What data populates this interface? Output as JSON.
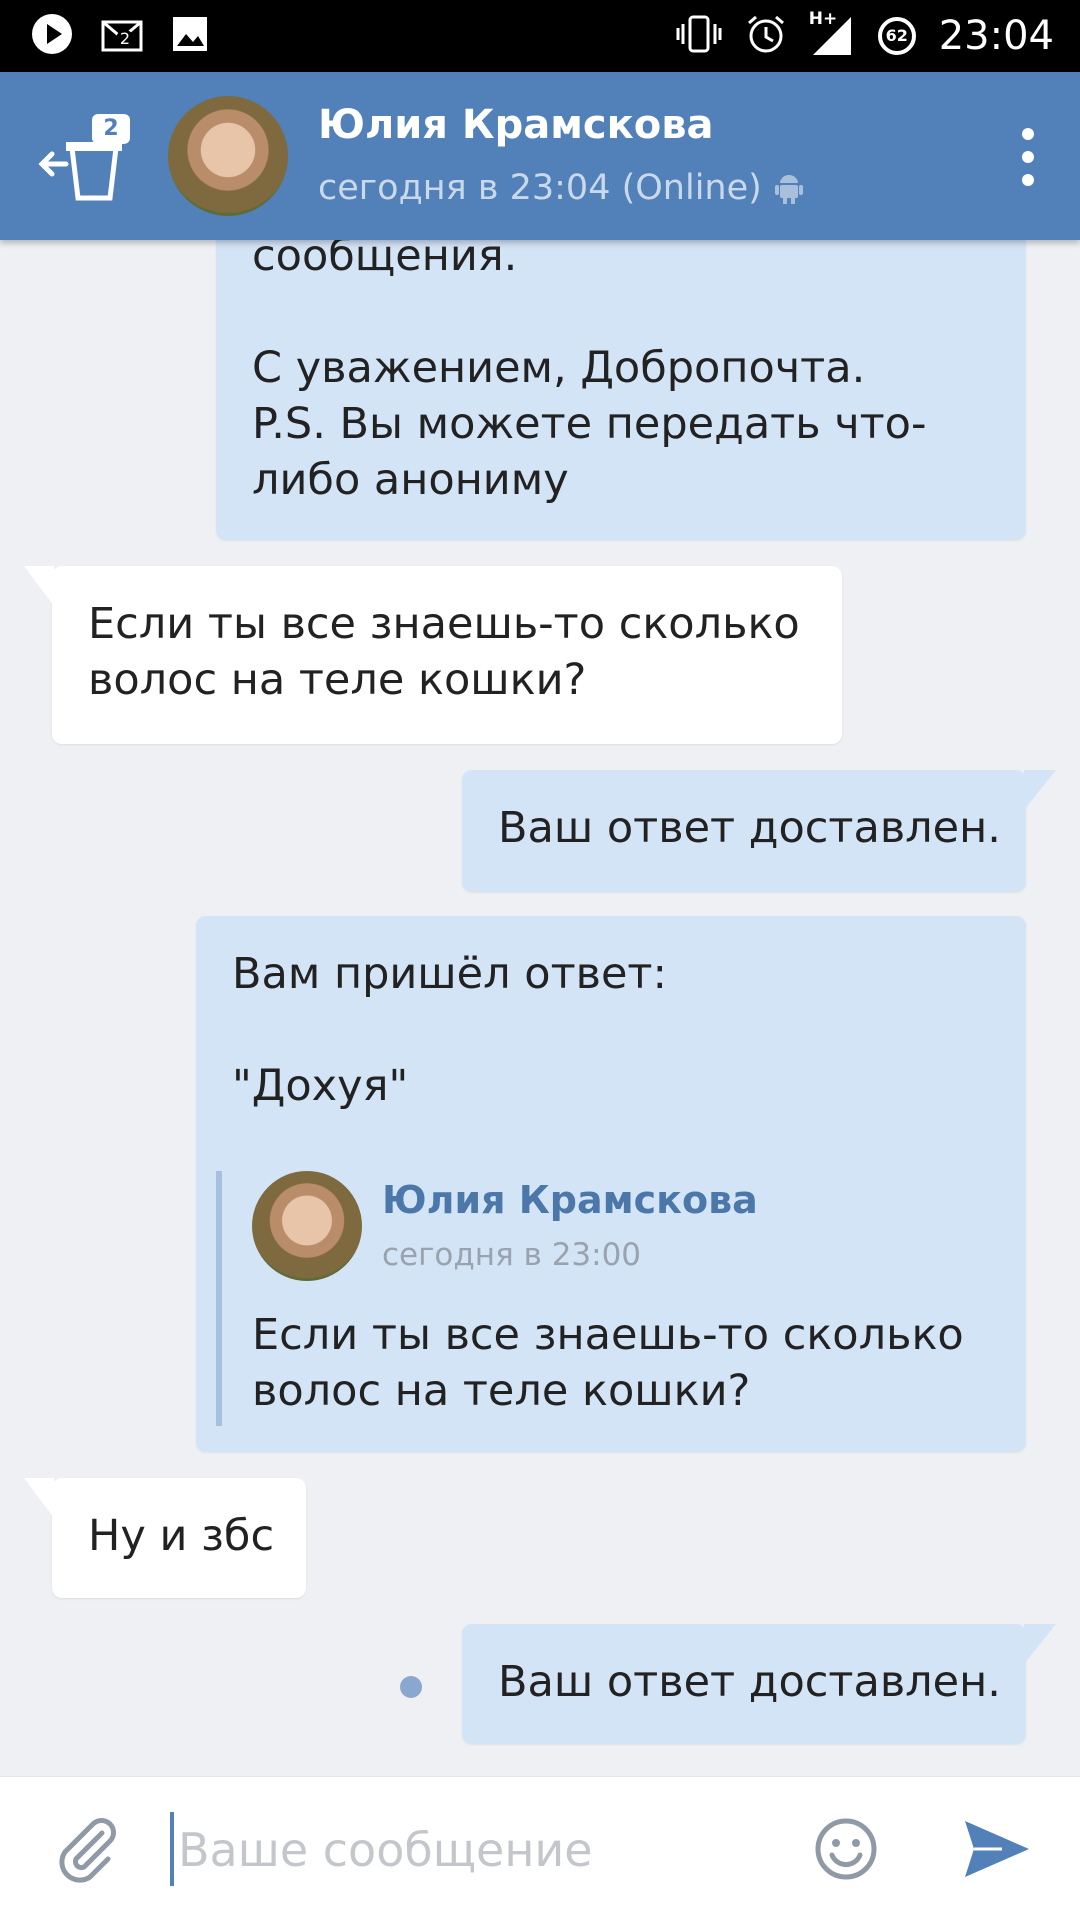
{
  "status_bar": {
    "time": "23:04",
    "mail_count": "2",
    "battery_level": "62",
    "network": "H+"
  },
  "header": {
    "back_badge": "2",
    "title": "Юлия Крамскова",
    "subtitle": "сегодня в 23:04 (Online)"
  },
  "messages": {
    "m1": "сообщения.\n\nС уважением, Добропочта.\nP.S. Вы можете передать что-\nлибо анониму",
    "m2": "Если ты все знаешь-то сколько\nволос на теле кошки?",
    "m3": "Ваш ответ доставлен.",
    "m4": "Вам пришёл ответ:\n\n\"Дохуя\"",
    "m4_quote": {
      "name": "Юлия Крамскова",
      "time": "сегодня в 23:00",
      "text": "Если ты все знаешь-то сколько\nволос на теле кошки?"
    },
    "m5": "Ну и збс",
    "m6": "Ваш ответ доставлен."
  },
  "composer": {
    "placeholder": "Ваше сообщение"
  },
  "colors": {
    "header": "#5181b8",
    "outgoing_bubble": "#d4e4f7",
    "incoming_bubble": "#ffffff",
    "background": "#eef0f3"
  },
  "icons": [
    "play-icon",
    "mail-icon",
    "image-icon",
    "vibrate-icon",
    "alarm-icon",
    "signal-icon",
    "battery-icon",
    "back-icon",
    "android-icon",
    "more-icon",
    "attach-icon",
    "emoji-icon",
    "send-icon"
  ]
}
